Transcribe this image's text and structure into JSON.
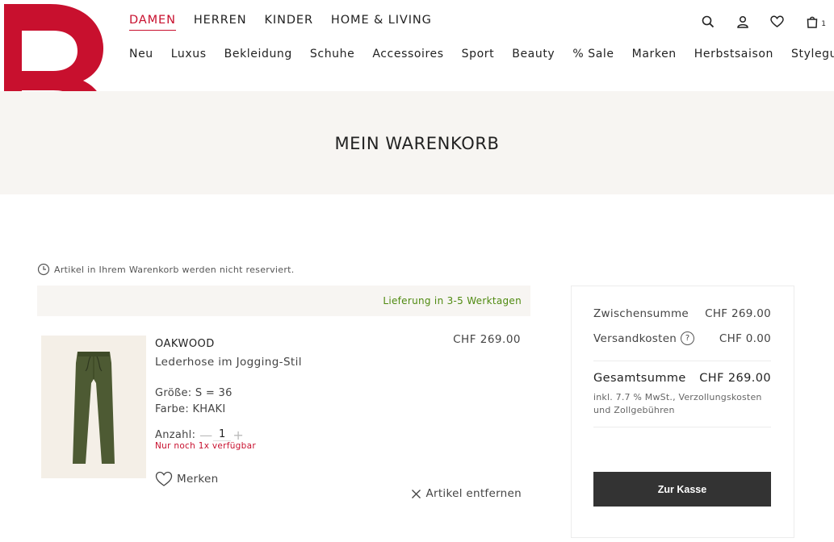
{
  "brand_color": "#c8102e",
  "logo": {
    "letter": "B",
    "icon": "brand-b-logo"
  },
  "gender_nav": [
    {
      "label": "DAMEN",
      "active": true
    },
    {
      "label": "HERREN",
      "active": false
    },
    {
      "label": "KINDER",
      "active": false
    },
    {
      "label": "HOME & LIVING",
      "active": false
    }
  ],
  "category_nav": [
    "Neu",
    "Luxus",
    "Bekleidung",
    "Schuhe",
    "Accessoires",
    "Sport",
    "Beauty",
    "% Sale",
    "Marken",
    "Herbstsaison",
    "Styleguide"
  ],
  "utility": {
    "icons": [
      "search-icon",
      "account-icon",
      "wishlist-heart-icon",
      "cart-bag-icon"
    ],
    "cart_count": "1"
  },
  "page_title": "MEIN WARENKORB",
  "notice": {
    "icon": "clock-icon",
    "text": "Artikel in Ihrem Warenkorb werden nicht reserviert."
  },
  "delivery": {
    "text": "Lieferung in 3-5 Werktagen",
    "color": "#4f8a10"
  },
  "item": {
    "brand": "OAKWOOD",
    "name": "Lederhose im Jogging-Stil",
    "price": "CHF 269.00",
    "size": "Größe: S = 36",
    "color": "Farbe: KHAKI",
    "qty_label": "Anzahl:",
    "qty_minus": "—",
    "qty": "1",
    "qty_plus": "+",
    "availability": "Nur noch 1x verfügbar",
    "wishlist_label": "Merken",
    "remove_label": "Artikel entfernen",
    "image_icon": "khaki-leather-trousers-image"
  },
  "summary": {
    "subtotal_label": "Zwischensumme",
    "subtotal_value": "CHF 269.00",
    "shipping_label": "Versandkosten",
    "shipping_help": "?",
    "shipping_value": "CHF 0.00",
    "total_label": "Gesamtsumme",
    "total_value": "CHF 269.00",
    "tax_note": "inkl. 7.7 % MwSt., Verzollungskosten und Zollgebühren",
    "checkout_label": "Zur Kasse"
  }
}
